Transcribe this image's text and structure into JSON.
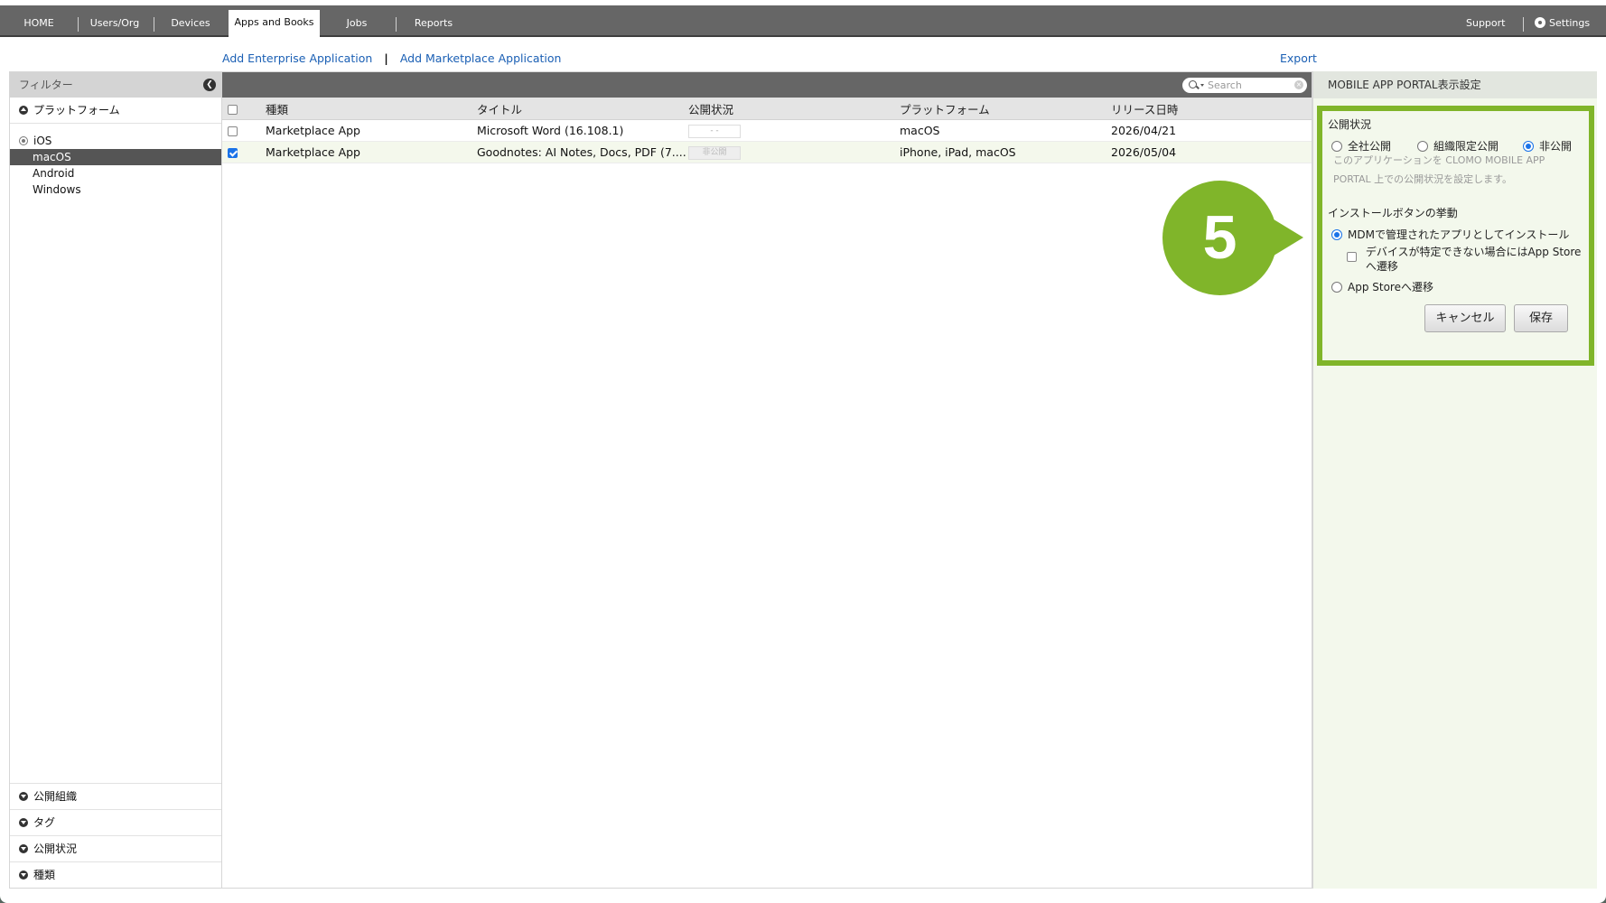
{
  "nav": {
    "tabs": [
      "HOME",
      "Users/Org",
      "Devices",
      "Apps and Books",
      "Jobs",
      "Reports"
    ],
    "active_tab": "Apps and Books",
    "support_label": "Support",
    "settings_label": "Settings"
  },
  "actions": {
    "add_enterprise": "Add Enterprise Application",
    "separator": "|",
    "add_marketplace": "Add Marketplace Application",
    "export": "Export"
  },
  "sidebar": {
    "title": "フィルター",
    "platform_section": "プラットフォーム",
    "platforms": {
      "ios": "iOS",
      "macos": "macOS",
      "android": "Android",
      "windows": "Windows"
    },
    "selected_platform": "macOS",
    "bottom_sections": {
      "org": "公開組織",
      "tag": "タグ",
      "status": "公開状況",
      "type": "種類"
    }
  },
  "table": {
    "search_placeholder": "Search",
    "columns": {
      "type": "種類",
      "title": "タイトル",
      "status": "公開状況",
      "platform": "プラットフォーム",
      "release": "リリース日時"
    },
    "rows": [
      {
        "type": "Marketplace App",
        "title": "Microsoft Word (16.108.1)",
        "status": "- -",
        "platform": "macOS",
        "release": "2026/04/21",
        "checked": false
      },
      {
        "type": "Marketplace App",
        "title": "Goodnotes: AI Notes, Docs, PDF (7....",
        "status": "非公開",
        "platform": "iPhone, iPad, macOS",
        "release": "2026/05/04",
        "checked": true
      }
    ]
  },
  "portal": {
    "header": "MOBILE APP PORTAL表示設定",
    "visibility_label": "公開状況",
    "visibility_options": {
      "all": "全社公開",
      "org": "組織限定公開",
      "private": "非公開"
    },
    "visibility_selected": "非公開",
    "visibility_desc_1": "このアプリケーションを CLOMO MOBILE APP",
    "visibility_desc_2": "PORTAL 上での公開状況を設定します。",
    "install_label": "インストールボタンの挙動",
    "install_mdm": "MDMで管理されたアプリとしてインストール",
    "fallback_line1": "デバイスが特定できない場合にはApp Store",
    "fallback_line2": "へ遷移",
    "install_appstore": "App Storeへ遷移",
    "install_selected": "MDMで管理されたアプリとしてインストール",
    "cancel_label": "キャンセル",
    "save_label": "保存"
  },
  "callout": {
    "step": "5",
    "color": "#80b52a"
  }
}
